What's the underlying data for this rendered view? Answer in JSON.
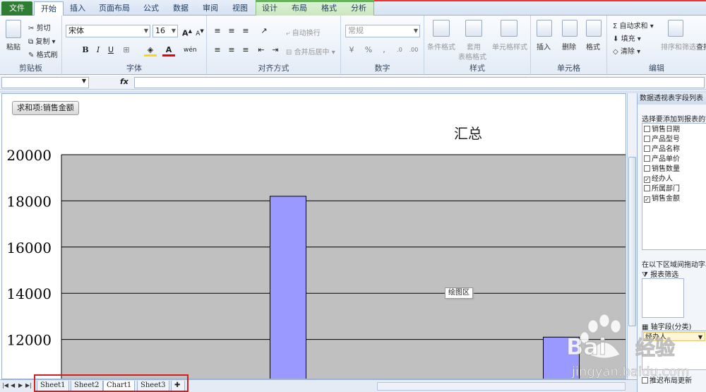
{
  "ribbon_tabs": [
    "文件",
    "开始",
    "插入",
    "页面布局",
    "公式",
    "数据",
    "审阅",
    "视图",
    "设计",
    "布局",
    "格式",
    "分析"
  ],
  "clipboard": {
    "paste": "粘贴",
    "cut": "剪切",
    "copy": "复制",
    "format_painter": "格式刷",
    "group": "剪贴板"
  },
  "font": {
    "name": "宋体",
    "size": "16",
    "group": "字体"
  },
  "alignment": {
    "wrap_text": "自动换行",
    "merge_center": "合并后居中",
    "group": "对齐方式"
  },
  "number": {
    "format": "常规",
    "group": "数字"
  },
  "styles": {
    "conditional": "条件格式",
    "table_line1": "套用",
    "table_line2": "表格格式",
    "cell_styles": "单元格样式",
    "group": "样式"
  },
  "cells": {
    "insert": "插入",
    "delete": "删除",
    "format": "格式",
    "group": "单元格"
  },
  "editing": {
    "autosum": "自动求和",
    "fill": "填充",
    "clear": "清除",
    "sort_filter": "排序和筛选",
    "find": "查找",
    "group": "编辑"
  },
  "formula_bar": {
    "fx": "fx"
  },
  "chart": {
    "field_button": "求和项:销售金额",
    "plot_area_tooltip": "绘图区",
    "colors": {
      "plot_bg": "#c0c0c0",
      "bar": "#9999ff"
    }
  },
  "chart_data": {
    "type": "bar",
    "title": "汇总",
    "ylim": [
      11200,
      20000
    ],
    "yticks": [
      "20000",
      "18000",
      "16000",
      "14000",
      "12000"
    ],
    "values": [
      18200,
      12100
    ],
    "grid": true
  },
  "pivot_panel": {
    "title": "数据透视表字段列表",
    "choose_label": "选择要添加到报表的字",
    "fields": [
      {
        "label": "销售日期",
        "checked": false
      },
      {
        "label": "产品型号",
        "checked": false
      },
      {
        "label": "产品名称",
        "checked": false
      },
      {
        "label": "产品单价",
        "checked": false
      },
      {
        "label": "销售数量",
        "checked": false
      },
      {
        "label": "经办人",
        "checked": true
      },
      {
        "label": "所属部门",
        "checked": false
      },
      {
        "label": "销售金额",
        "checked": true
      }
    ],
    "drag_label": "在以下区域间拖动字段",
    "report_filter": "报表筛选",
    "axis_fields": "轴字段(分类)",
    "axis_value": "经办人",
    "defer_update": "推迟布局更新"
  },
  "sheet_tabs": [
    "Sheet1",
    "Sheet2",
    "Chart1",
    "Sheet3"
  ],
  "watermark": {
    "brand": "Baidu 经验",
    "url": "jingyan.baidu.com"
  }
}
